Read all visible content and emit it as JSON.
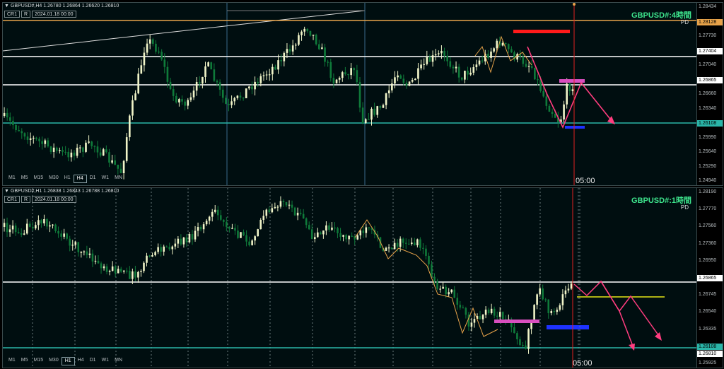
{
  "colors": {
    "bg": "#000e10",
    "bull": "#f0f4c8",
    "bear": "#0f7a3a",
    "orange_line": "#e8a34a",
    "white_line": "#ffffff",
    "teal_line": "#2ab5a8",
    "red": "#ff1a1a",
    "magenta": "#d94fbf",
    "blue": "#1e32ff",
    "pink_arrow": "#ff3d7f",
    "yellow_line": "#e6e615",
    "vline": "#e02020",
    "title": "#3de38c"
  },
  "pane1": {
    "infobar": "GBPUSD#,H4  1.26780 1.26864 1.26620 1.26810",
    "cr": "CR1",
    "r": "R",
    "date": "2024.01.18 00:00",
    "title": "GBPUSD#:4時間",
    "pd": "PD",
    "price_ticks": [
      "1.28434",
      "1.28128",
      "1.27730",
      "1.27404",
      "1.27040",
      "1.26865",
      "1.26660",
      "1.26340",
      "1.26108",
      "1.25990",
      "1.25640",
      "1.25290",
      "1.24940"
    ],
    "highlight_tags": [
      {
        "value": "1.28128",
        "color": "#e8a34a"
      },
      {
        "value": "1.27404",
        "color": "#ffffff"
      },
      {
        "value": "1.26865",
        "color": "#ffffff"
      },
      {
        "value": "1.26108",
        "color": "#2ab5a8"
      }
    ],
    "timeframes": [
      "M1",
      "M5",
      "M15",
      "M30",
      "H1",
      "H4",
      "D1",
      "W1",
      "MN"
    ],
    "selected_tf": "H4",
    "time_label": "05:00",
    "ohlc_hint": {
      "start": 1.26,
      "levels": {
        "orange": 1.28128,
        "white1": 1.27404,
        "white2": 1.26865,
        "teal": 1.26108
      }
    }
  },
  "pane2": {
    "infobar": "GBPUSD#,H1  1.26838 1.26843 1.26788 1.26810",
    "cr": "CR1",
    "r": "R",
    "date": "2024.01.18 00:00",
    "title": "GBPUSD#:1時間",
    "pd": "PD",
    "price_ticks": [
      "1.28190",
      "1.27770",
      "1.27560",
      "1.27360",
      "1.26950",
      "1.26865",
      "1.26745",
      "1.26540",
      "1.26335",
      "1.26108",
      "1.25925"
    ],
    "highlight_tags": [
      {
        "value": "1.26865",
        "color": "#ffffff"
      },
      {
        "value": "1.26810",
        "color": "#ffffff"
      },
      {
        "value": "1.26108",
        "color": "#2ab5a8"
      }
    ],
    "timeframes": [
      "M1",
      "M5",
      "M15",
      "M30",
      "H1",
      "H4",
      "D1",
      "W1",
      "MN"
    ],
    "selected_tf": "H1",
    "time_label": "05:00"
  }
}
